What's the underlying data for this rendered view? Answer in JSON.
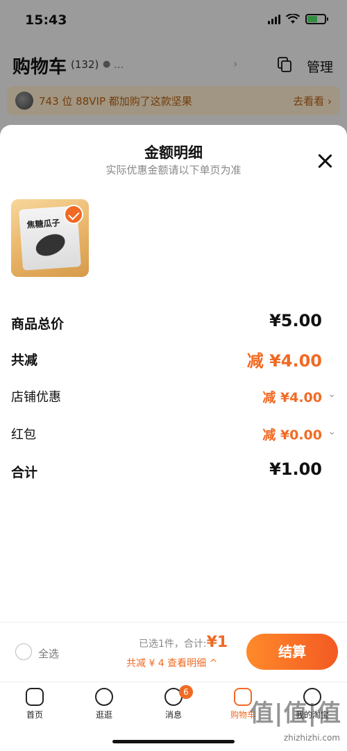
{
  "status_bar": {
    "time": "15:43"
  },
  "cart_header": {
    "title": "购物车",
    "count": "(132)",
    "location_text": "...",
    "manage_label": "管理"
  },
  "promo": {
    "text": "743 位 88VIP 都加购了这款坚果",
    "link": "去看看 ›"
  },
  "sheet": {
    "title": "金额明细",
    "subtitle": "实际优惠金额请以下单页为准",
    "rows": [
      {
        "label": "商品总价",
        "value": "¥5.00"
      },
      {
        "label": "共减",
        "value": "减 ¥4.00"
      },
      {
        "label": "店铺优惠",
        "value": "减 ¥4.00"
      },
      {
        "label": "红包",
        "value": "减 ¥0.00"
      },
      {
        "label": "合计",
        "value": "¥1.00"
      }
    ],
    "product_title": "焦糖瓜子"
  },
  "bottom_bar": {
    "select_all": "全选",
    "selected_summary": "已选1件，合计:",
    "total": "¥1",
    "discount_link": "共减 ¥ 4  查看明细 ^",
    "checkout": "结算"
  },
  "tabs": [
    {
      "label": "首页"
    },
    {
      "label": "逛逛"
    },
    {
      "label": "消息",
      "badge": "6"
    },
    {
      "label": "购物车"
    },
    {
      "label": "我的淘宝"
    }
  ],
  "watermark": {
    "main": "值|值|值",
    "sub": "zhizhizhi.com"
  },
  "colors": {
    "accent": "#f06a24",
    "promo_bg": "#f6e6c9"
  }
}
